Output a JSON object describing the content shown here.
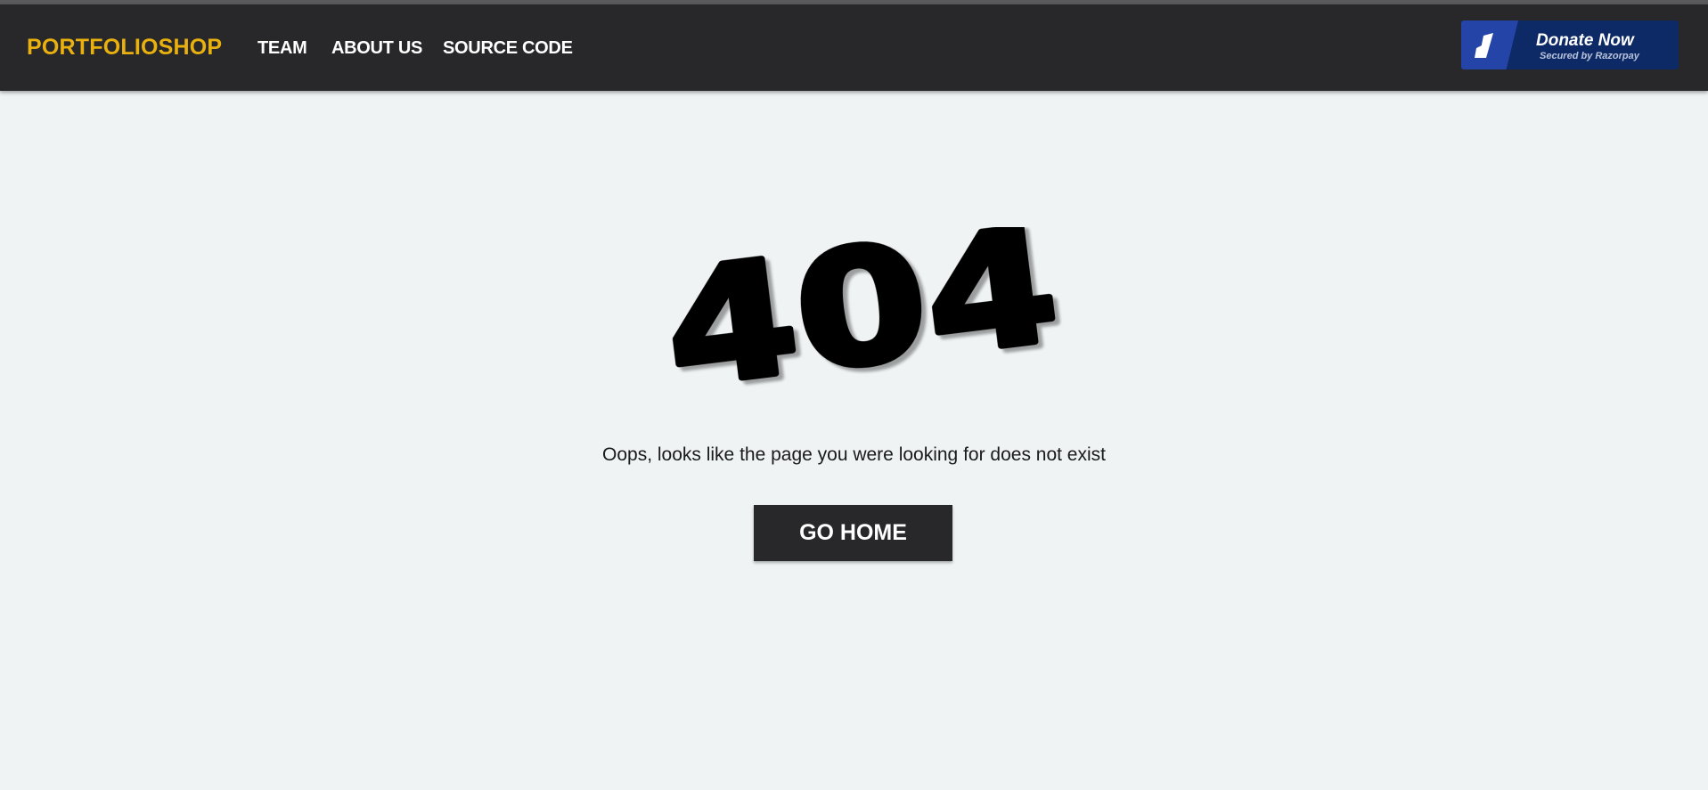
{
  "navbar": {
    "brand": "PORTFOLIOSHOP",
    "links": [
      {
        "label": "TEAM"
      },
      {
        "label": "ABOUT US"
      },
      {
        "label": "SOURCE CODE"
      }
    ],
    "donate": {
      "title": "Donate Now",
      "subtitle": "Secured by Razorpay",
      "icon": "razorpay-logo-icon"
    }
  },
  "main": {
    "error_code": "404",
    "message": "Oops, looks like the page you were looking for does not exist",
    "home_button": "GO HOME"
  },
  "colors": {
    "brand": "#e9b10f",
    "navbar_bg": "#28282a",
    "page_bg": "#eff3f4",
    "donate_bg": "#0d2a66",
    "donate_accent": "#2444a8"
  }
}
